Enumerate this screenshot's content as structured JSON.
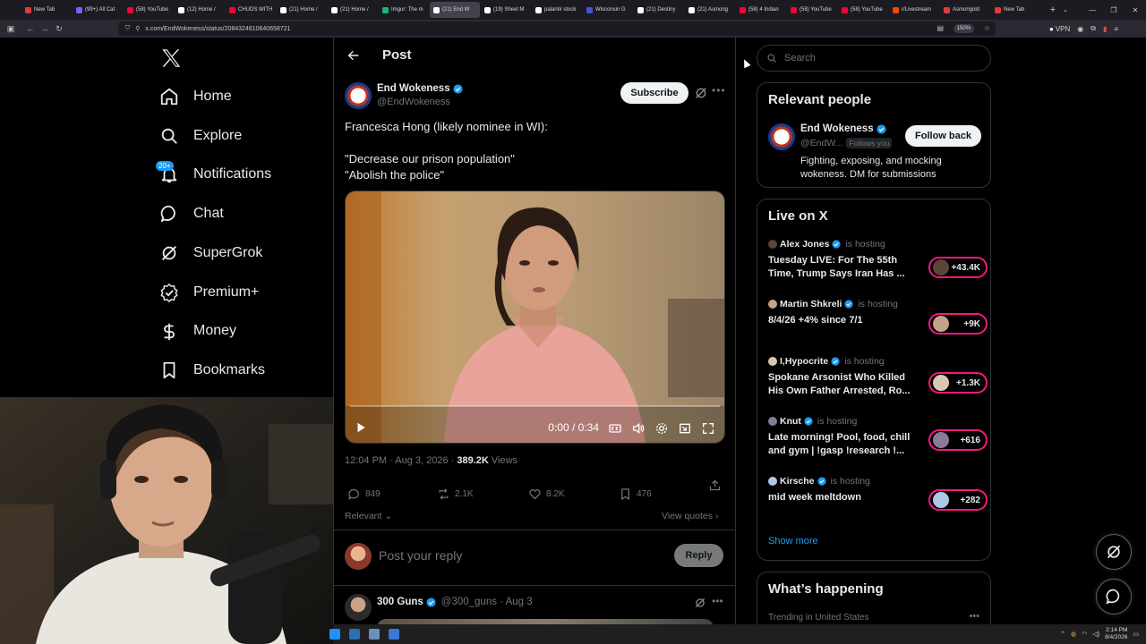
{
  "browser": {
    "tabs": [
      {
        "label": "New Tab",
        "color": "#e03c3c"
      },
      {
        "label": "(99+) All Cat",
        "color": "#7b61ff"
      },
      {
        "label": "(58) YouTube",
        "color": "#ff0033"
      },
      {
        "label": "(12) Home /",
        "color": "#ffffff"
      },
      {
        "label": "CHUDS WITH",
        "color": "#ff0033"
      },
      {
        "label": "(21) Home /",
        "color": "#ffffff"
      },
      {
        "label": "(21) Home /",
        "color": "#ffffff"
      },
      {
        "label": "Imgur: The m",
        "color": "#1bb76e"
      },
      {
        "label": "(21) End W",
        "color": "#ffffff",
        "active": true
      },
      {
        "label": "(19) Sheel M",
        "color": "#ffffff"
      },
      {
        "label": "palantir stock",
        "color": "#ffffff"
      },
      {
        "label": "Wisconsin G",
        "color": "#3a5ad9"
      },
      {
        "label": "(21) Destiny",
        "color": "#ffffff"
      },
      {
        "label": "(21) Asmong",
        "color": "#ffffff"
      },
      {
        "label": "(58) 4 Indian",
        "color": "#ff0033"
      },
      {
        "label": "(58) YouTube",
        "color": "#ff0033"
      },
      {
        "label": "(58) YouTube",
        "color": "#ff0033"
      },
      {
        "label": "r/Livestream",
        "color": "#ff4500"
      },
      {
        "label": "Asmongold",
        "color": "#e03c3c"
      },
      {
        "label": "New Tab",
        "color": "#e03c3c"
      }
    ],
    "url": "x.com/EndWokeness/status/2084324610640658721",
    "zoom": "150%",
    "vpn_label": "VPN"
  },
  "nav": {
    "items": [
      {
        "id": "home",
        "label": "Home"
      },
      {
        "id": "explore",
        "label": "Explore"
      },
      {
        "id": "notifications",
        "label": "Notifications"
      },
      {
        "id": "chat",
        "label": "Chat"
      },
      {
        "id": "supergrok",
        "label": "SuperGrok"
      },
      {
        "id": "premium",
        "label": "Premium+"
      },
      {
        "id": "money",
        "label": "Money"
      },
      {
        "id": "bookmarks",
        "label": "Bookmarks"
      }
    ],
    "notifications_badge": "20+"
  },
  "post": {
    "header_title": "Post",
    "author_name": "End Wokeness",
    "author_handle": "@EndWokeness",
    "subscribe_label": "Subscribe",
    "text_line1": "Francesca Hong (likely nominee in WI):",
    "text_line2": "\"Decrease our prison population\"",
    "text_line3": "\"Abolish the police\"",
    "video_time": "0:00 / 0:34",
    "video_progress": 0,
    "timestamp": "12:04 PM · Aug 3, 2026 · ",
    "views_count": "389.2K",
    "views_label": " Views",
    "replies": "849",
    "reposts": "2.1K",
    "likes": "8.2K",
    "bookmarks": "476",
    "sort_label": "Relevant",
    "view_quotes": "View quotes",
    "reply_placeholder": "Post your reply",
    "reply_button": "Reply"
  },
  "reply_tweet": {
    "name": "300 Guns",
    "handle_time": "@300_guns · Aug 3"
  },
  "sidebar": {
    "search_placeholder": "Search",
    "relevant_people": {
      "title": "Relevant people",
      "name": "End Wokeness",
      "handle": "@EndW...",
      "follows_you": "Follows you",
      "follow_button": "Follow back",
      "bio": "Fighting, exposing, and mocking wokeness. DM for submissions"
    },
    "live": {
      "title": "Live on X",
      "hosting_label": "is hosting",
      "items": [
        {
          "host": "Alex Jones",
          "title": "Tuesday LIVE: For The 55th Time, Trump Says Iran Has ...",
          "count": "+43.4K"
        },
        {
          "host": "Martin Shkreli",
          "title": "8/4/26 +4% since 7/1",
          "count": "+9K"
        },
        {
          "host": "I,Hypocrite",
          "title": "Spokane Arsonist Who Killed His Own Father Arrested, Ro...",
          "count": "+1.3K"
        },
        {
          "host": "Knut",
          "title": "Late morning! Pool, food, chill and gym | !gasp !research !...",
          "count": "+616"
        },
        {
          "host": "Kirsche",
          "title": "mid week meltdown",
          "count": "+282"
        }
      ],
      "show_more": "Show more"
    },
    "happening": {
      "title": "What’s happening",
      "trending_label": "Trending in United States"
    }
  },
  "taskbar": {
    "time": "2:14 PM",
    "date": "8/4/2026"
  },
  "colors": {
    "accent": "#1d9bf0",
    "live_pink": "#f91880",
    "border": "#2f3336",
    "muted": "#71767b"
  }
}
